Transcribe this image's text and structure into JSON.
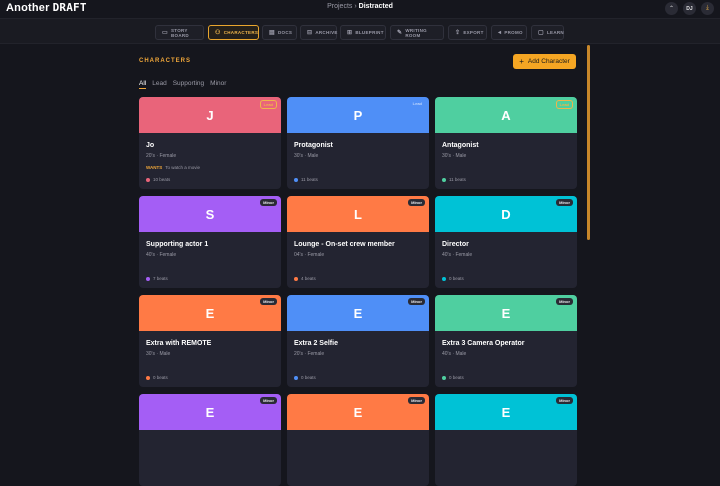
{
  "app": {
    "logo_a": "Another",
    "logo_b": "DRAFT"
  },
  "breadcrumb": {
    "parent": "Projects",
    "sep": "›",
    "current": "Distracted"
  },
  "topbar": {
    "avatar": "DJ"
  },
  "tabs": [
    {
      "label": "STORY BOARD",
      "icon": "▭"
    },
    {
      "label": "CHARACTERS",
      "icon": "⚇",
      "active": true
    },
    {
      "label": "DOCS",
      "icon": "▤"
    },
    {
      "label": "ARCHIVE",
      "icon": "⊟"
    },
    {
      "label": "BLUEPRINT",
      "icon": "⊞"
    },
    {
      "label": "WRITING ROOM",
      "icon": "✎"
    },
    {
      "label": "EXPORT",
      "icon": "⇪"
    },
    {
      "label": "PROMO",
      "icon": "◂"
    },
    {
      "label": "LEARN",
      "icon": "▢"
    }
  ],
  "main": {
    "title": "CHARACTERS",
    "add_button": "Add Character",
    "filters": [
      "All",
      "Lead",
      "Supporting",
      "Minor"
    ]
  },
  "cards": [
    {
      "initial": "J",
      "color": "#e9647a",
      "badge": "Lead",
      "badge_style": "lead",
      "name": "Jo",
      "meta": "20's · Female",
      "want_label": "WANTS",
      "want": "To watch a movie",
      "beats": "10 beats",
      "dot": "#e9647a"
    },
    {
      "initial": "P",
      "color": "#4f8ff7",
      "badge": "Lead",
      "badge_style": "ghost",
      "name": "Protagonist",
      "meta": "30's · Male",
      "beats": "11 beats",
      "dot": "#4f8ff7"
    },
    {
      "initial": "A",
      "color": "#4fcfa0",
      "badge": "Lead",
      "badge_style": "lead",
      "name": "Antagonist",
      "meta": "30's · Male",
      "beats": "11 beats",
      "dot": "#4fcfa0"
    },
    {
      "initial": "S",
      "color": "#a45ef5",
      "badge": "Minor",
      "name": "Supporting actor 1",
      "meta": "40's · Female",
      "beats": "7 beats",
      "dot": "#a45ef5"
    },
    {
      "initial": "L",
      "color": "#ff7a45",
      "badge": "Minor",
      "name": "Lounge - On-set crew member",
      "meta": "04's · Female",
      "beats": "4 beats",
      "dot": "#ff7a45"
    },
    {
      "initial": "D",
      "color": "#00c2d6",
      "badge": "Minor",
      "name": "Director",
      "meta": "40's · Female",
      "beats": "0 beats",
      "dot": "#00c2d6"
    },
    {
      "initial": "E",
      "color": "#ff7a45",
      "badge": "Minor",
      "name": "Extra with REMOTE",
      "meta": "30's · Male",
      "beats": "0 beats",
      "dot": "#ff7a45"
    },
    {
      "initial": "E",
      "color": "#4f8ff7",
      "badge": "Minor",
      "name": "Extra 2 Selfie",
      "meta": "20's · Female",
      "beats": "0 beats",
      "dot": "#4f8ff7"
    },
    {
      "initial": "E",
      "color": "#4fcfa0",
      "badge": "Minor",
      "name": "Extra 3 Camera Operator",
      "meta": "40's · Male",
      "beats": "0 beats",
      "dot": "#4fcfa0"
    },
    {
      "initial": "E",
      "color": "#a45ef5",
      "badge": "Minor"
    },
    {
      "initial": "E",
      "color": "#ff7a45",
      "badge": "Minor"
    },
    {
      "initial": "E",
      "color": "#00c2d6",
      "badge": "Minor"
    }
  ]
}
